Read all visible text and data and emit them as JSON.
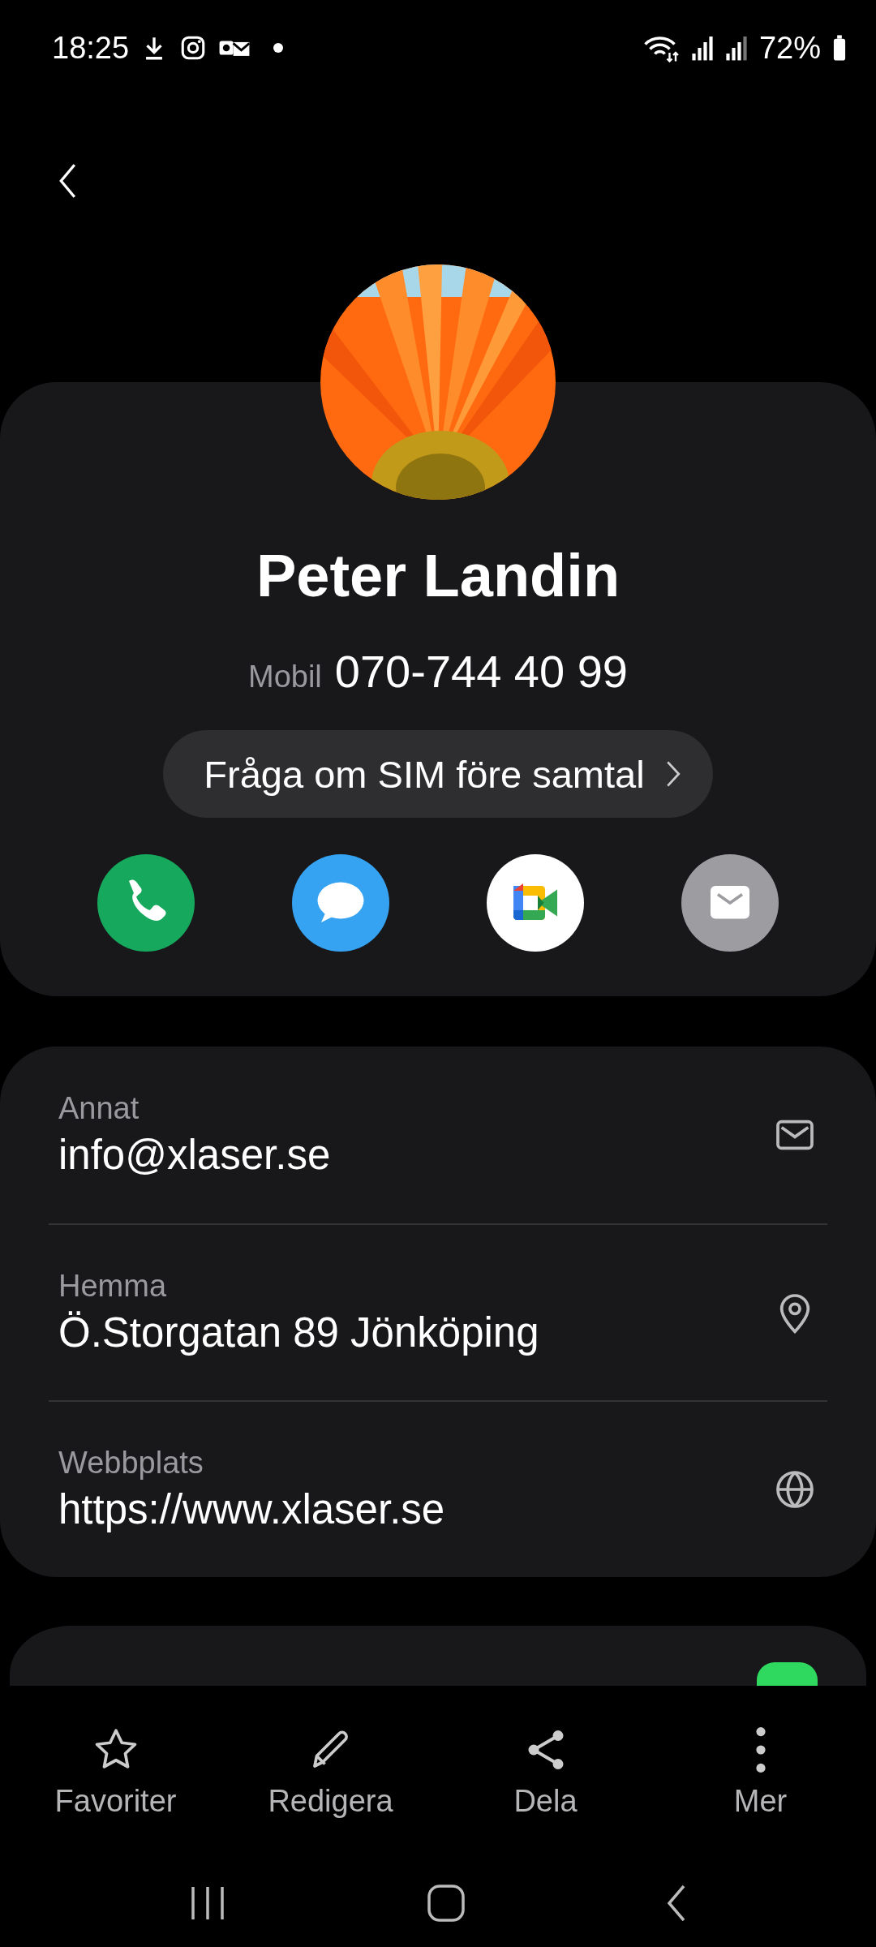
{
  "status_bar": {
    "time": "18:25",
    "battery": "72%"
  },
  "contact": {
    "name": "Peter Landin",
    "phone_label": "Mobil",
    "phone": "070-744 40 99",
    "sim_button": "Fråga om SIM före samtal"
  },
  "quick_actions": [
    {
      "kind": "call"
    },
    {
      "kind": "message"
    },
    {
      "kind": "video"
    },
    {
      "kind": "email"
    }
  ],
  "details": [
    {
      "label": "Annat",
      "value": "info@xlaser.se",
      "kind": "email"
    },
    {
      "label": "Hemma",
      "value": "Ö.Storgatan 89 Jönköping",
      "kind": "location"
    },
    {
      "label": "Webbplats",
      "value": "https://www.xlaser.se",
      "kind": "web"
    }
  ],
  "toolbar": [
    {
      "label": "Favoriter",
      "kind": "star"
    },
    {
      "label": "Redigera",
      "kind": "edit"
    },
    {
      "label": "Dela",
      "kind": "share"
    },
    {
      "label": "Mer",
      "kind": "more"
    }
  ]
}
